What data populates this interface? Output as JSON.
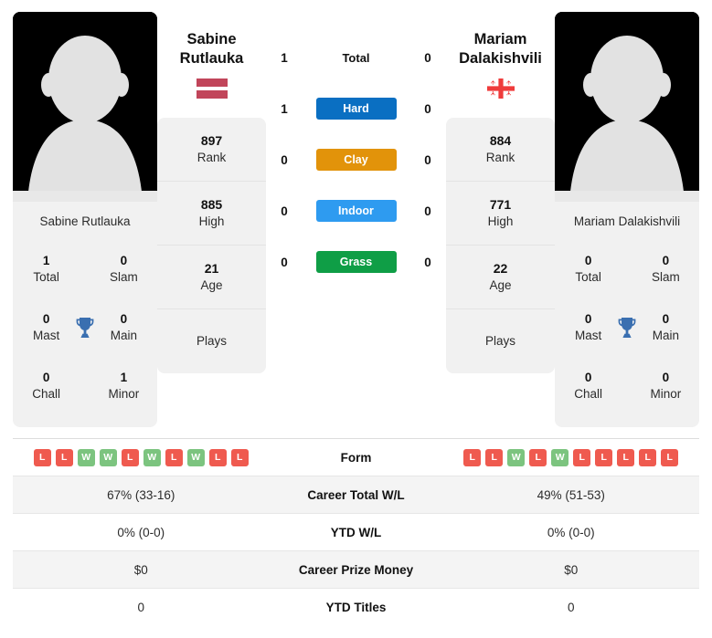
{
  "players": {
    "left": {
      "name_line1": "Sabine",
      "name_line2": "Rutlauka",
      "full_name": "Sabine Rutlauka",
      "flag": "latvia-flag",
      "titles": {
        "total_value": "1",
        "total_label": "Total",
        "slam_value": "0",
        "slam_label": "Slam",
        "mast_value": "0",
        "mast_label": "Mast",
        "main_value": "0",
        "main_label": "Main",
        "chall_value": "0",
        "chall_label": "Chall",
        "minor_value": "1",
        "minor_label": "Minor"
      },
      "stats": [
        {
          "value": "897",
          "label": "Rank"
        },
        {
          "value": "885",
          "label": "High"
        },
        {
          "value": "21",
          "label": "Age"
        },
        {
          "value": "",
          "label": "Plays"
        }
      ],
      "surface_wins": {
        "total": "1",
        "hard": "1",
        "clay": "0",
        "indoor": "0",
        "grass": "0"
      },
      "form": [
        "L",
        "L",
        "W",
        "W",
        "L",
        "W",
        "L",
        "W",
        "L",
        "L"
      ],
      "career_total_wl": "67% (33-16)",
      "ytd_wl": "0% (0-0)",
      "career_prize_money": "$0",
      "ytd_titles": "0"
    },
    "right": {
      "name_line1": "Mariam",
      "name_line2": "Dalakishvili",
      "full_name": "Mariam Dalakishvili",
      "flag": "georgia-flag",
      "titles": {
        "total_value": "0",
        "total_label": "Total",
        "slam_value": "0",
        "slam_label": "Slam",
        "mast_value": "0",
        "mast_label": "Mast",
        "main_value": "0",
        "main_label": "Main",
        "chall_value": "0",
        "chall_label": "Chall",
        "minor_value": "0",
        "minor_label": "Minor"
      },
      "stats": [
        {
          "value": "884",
          "label": "Rank"
        },
        {
          "value": "771",
          "label": "High"
        },
        {
          "value": "22",
          "label": "Age"
        },
        {
          "value": "",
          "label": "Plays"
        }
      ],
      "surface_wins": {
        "total": "0",
        "hard": "0",
        "clay": "0",
        "indoor": "0",
        "grass": "0"
      },
      "form": [
        "L",
        "L",
        "W",
        "L",
        "W",
        "L",
        "L",
        "L",
        "L",
        "L"
      ],
      "career_total_wl": "49% (51-53)",
      "ytd_wl": "0% (0-0)",
      "career_prize_money": "$0",
      "ytd_titles": "0"
    }
  },
  "surfaces": [
    {
      "key": "total",
      "label": "Total",
      "color": "transparent",
      "text_color": "#111111"
    },
    {
      "key": "hard",
      "label": "Hard",
      "color": "#0a6fc2",
      "text_color": "#ffffff"
    },
    {
      "key": "clay",
      "label": "Clay",
      "color": "#e2930a",
      "text_color": "#ffffff"
    },
    {
      "key": "indoor",
      "label": "Indoor",
      "color": "#2e9bf0",
      "text_color": "#ffffff"
    },
    {
      "key": "grass",
      "label": "Grass",
      "color": "#0f9e46",
      "text_color": "#ffffff"
    }
  ],
  "table_rows": [
    {
      "key": "form",
      "label": "Form"
    },
    {
      "key": "career_wl",
      "label": "Career Total W/L"
    },
    {
      "key": "ytd_wl",
      "label": "YTD W/L"
    },
    {
      "key": "prize",
      "label": "Career Prize Money"
    },
    {
      "key": "ytd_titles",
      "label": "YTD Titles"
    }
  ],
  "colors": {
    "win_badge": "#7cc47f",
    "loss_badge": "#ef5a4f",
    "card_bg": "#f1f1f1",
    "trophy": "#3a6fb0"
  }
}
